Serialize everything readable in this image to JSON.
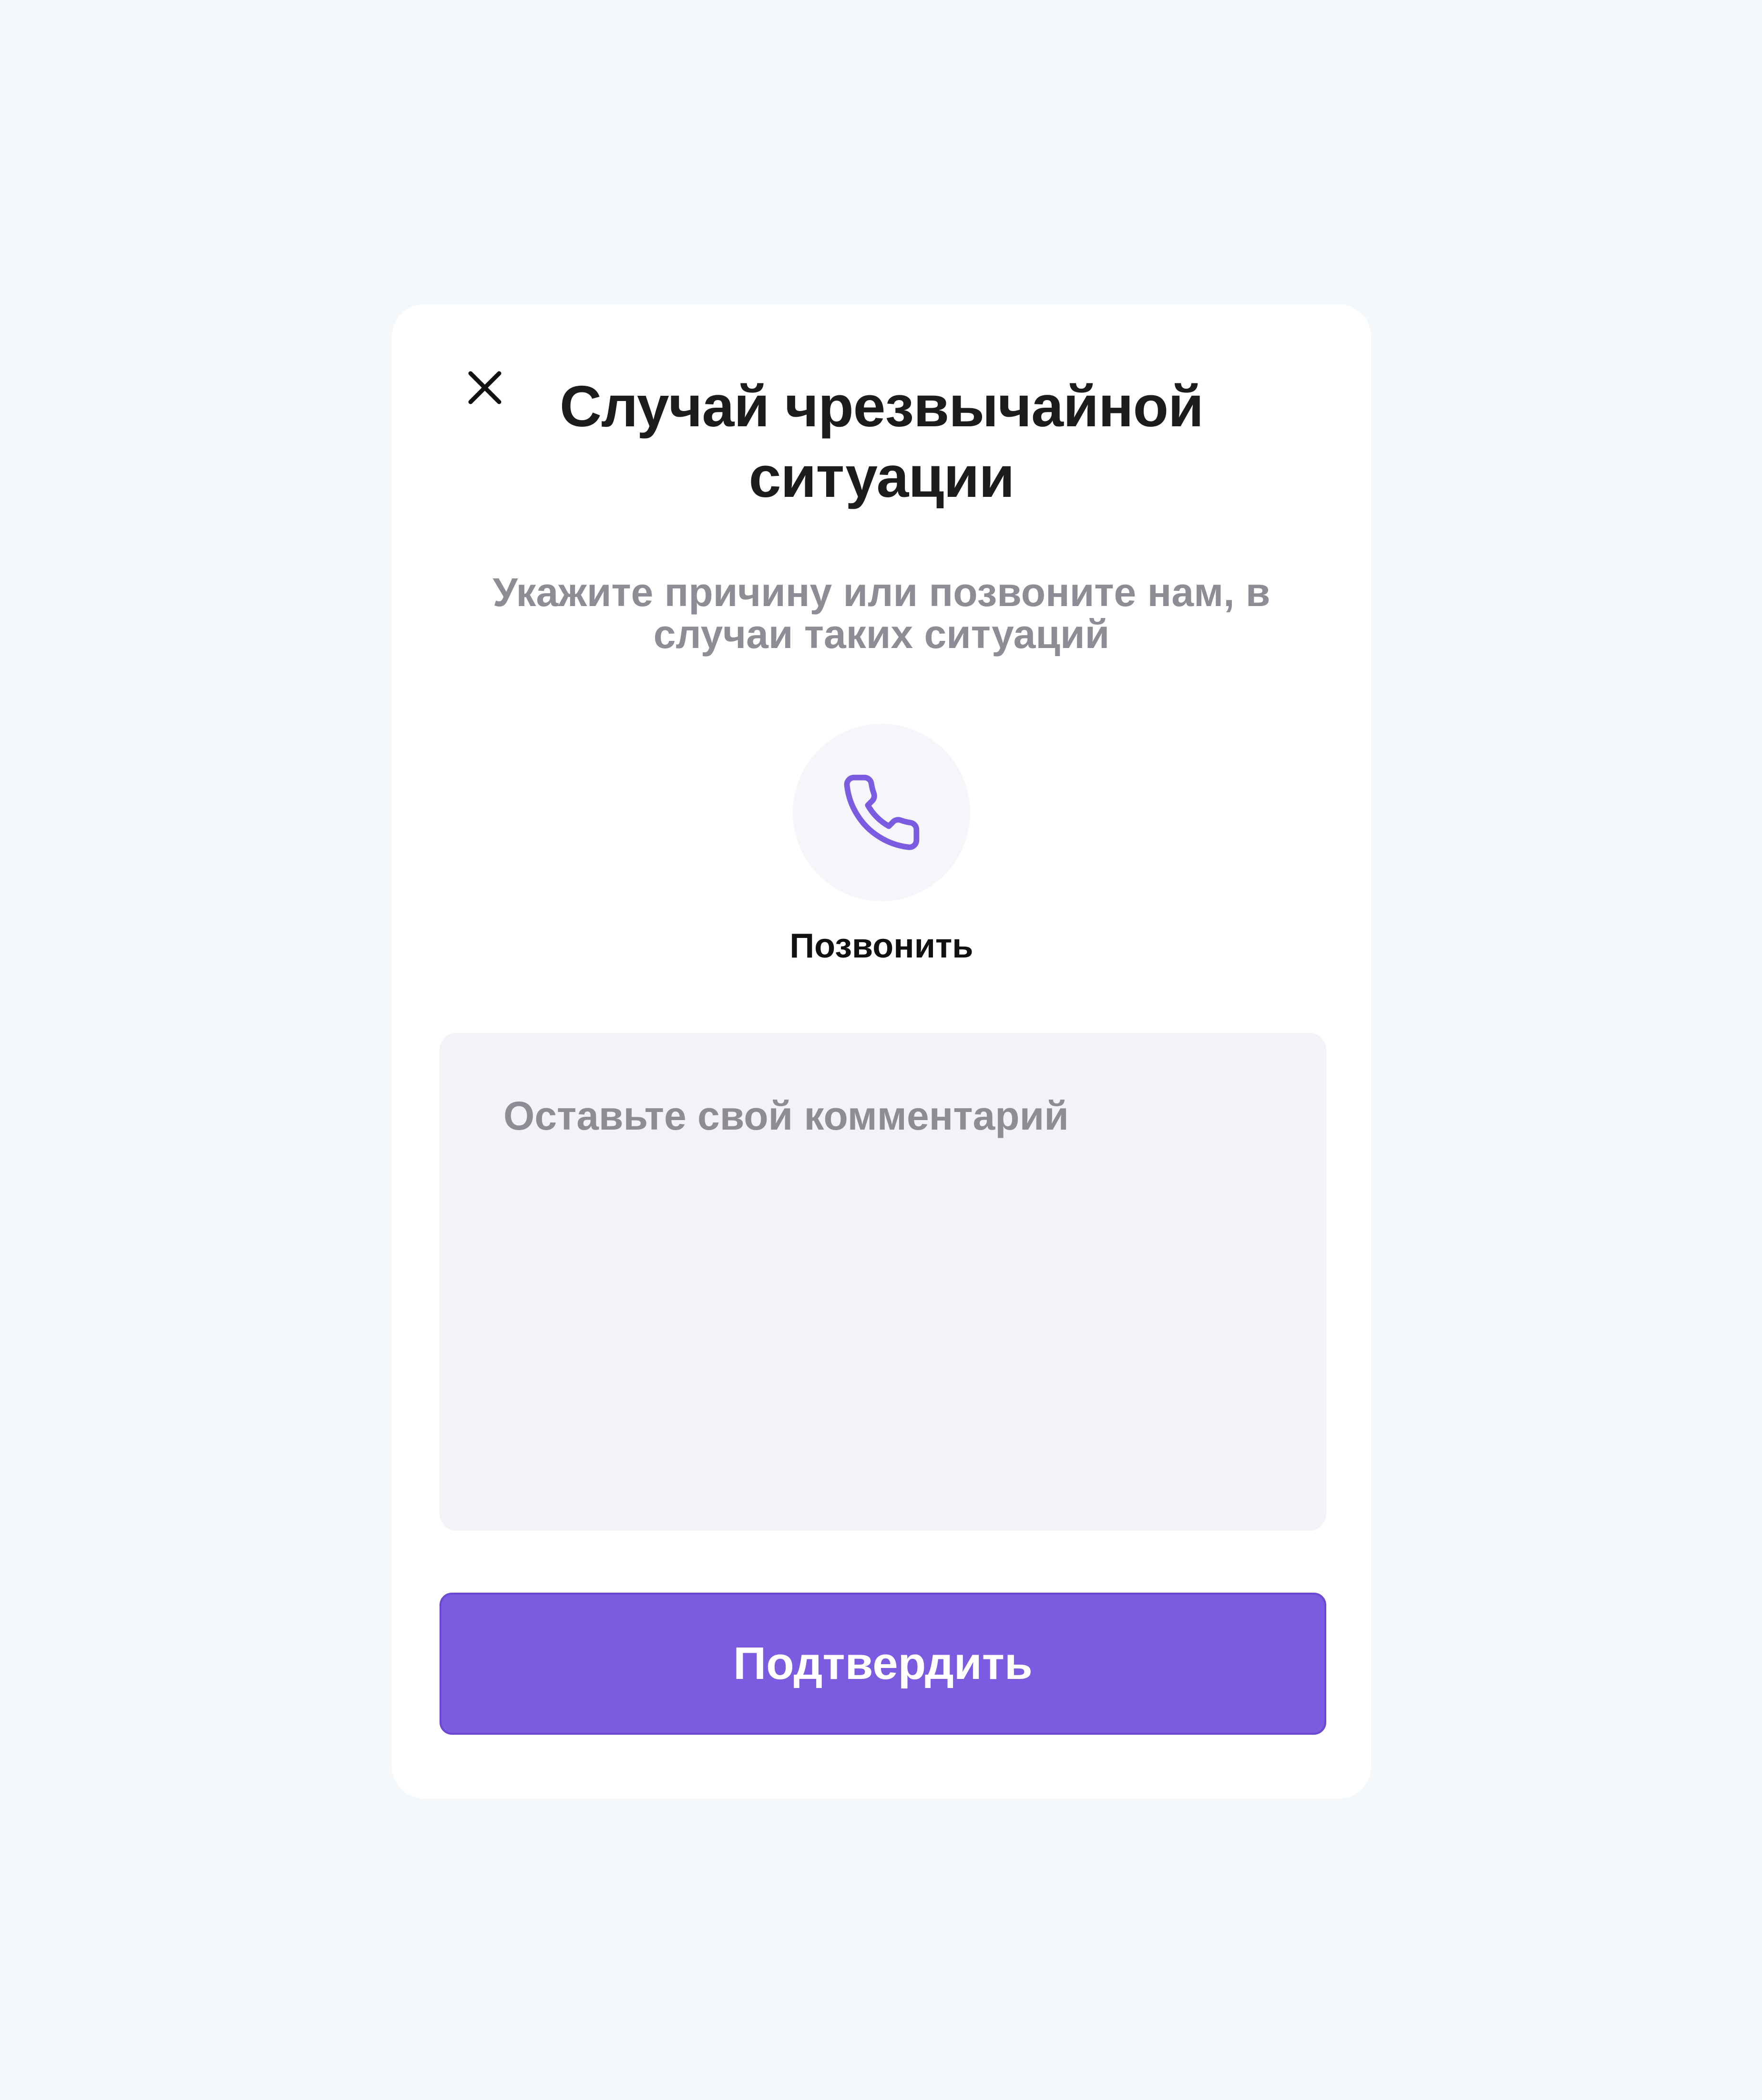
{
  "modal": {
    "title": "Случай чрезвычайной ситуации",
    "subtitle": "Укажите причину или позвоните нам, в случаи таких ситуаций",
    "close_icon": "close-icon",
    "call": {
      "icon": "phone-icon",
      "label": "Позвонить"
    },
    "comment": {
      "placeholder": "Оставьте свой комментарий",
      "value": ""
    },
    "confirm_label": "Подтвердить"
  },
  "colors": {
    "background": "#f5f8fb",
    "accent": "#7b5be0",
    "title_text": "#1c1c1e",
    "muted_text": "#8e8d95",
    "input_bg": "#f2f2f7",
    "call_circle_bg": "#f6f6fa"
  }
}
